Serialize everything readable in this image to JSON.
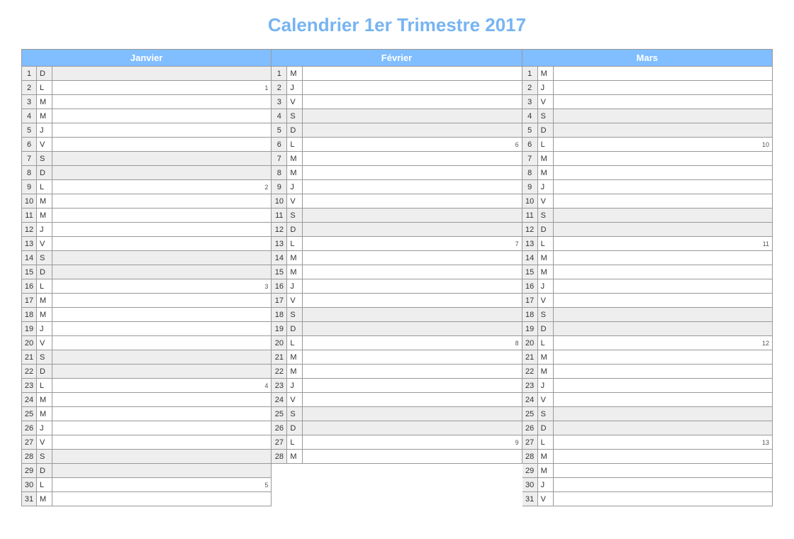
{
  "title": "Calendrier 1er Trimestre 2017",
  "colors": {
    "accent": "#80beff",
    "titleColor": "#77b4f2",
    "shade": "#eee"
  },
  "dowLetters": {
    "mon": "L",
    "tue": "M",
    "wed": "M",
    "thu": "J",
    "fri": "V",
    "sat": "S",
    "sun": "D"
  },
  "months": [
    {
      "name": "Janvier",
      "days": [
        {
          "n": 1,
          "dow": "D",
          "weekend": true,
          "holiday": true
        },
        {
          "n": 2,
          "dow": "L",
          "week": 1
        },
        {
          "n": 3,
          "dow": "M"
        },
        {
          "n": 4,
          "dow": "M"
        },
        {
          "n": 5,
          "dow": "J"
        },
        {
          "n": 6,
          "dow": "V"
        },
        {
          "n": 7,
          "dow": "S",
          "weekend": true
        },
        {
          "n": 8,
          "dow": "D",
          "weekend": true
        },
        {
          "n": 9,
          "dow": "L",
          "week": 2
        },
        {
          "n": 10,
          "dow": "M"
        },
        {
          "n": 11,
          "dow": "M"
        },
        {
          "n": 12,
          "dow": "J"
        },
        {
          "n": 13,
          "dow": "V"
        },
        {
          "n": 14,
          "dow": "S",
          "weekend": true
        },
        {
          "n": 15,
          "dow": "D",
          "weekend": true
        },
        {
          "n": 16,
          "dow": "L",
          "week": 3
        },
        {
          "n": 17,
          "dow": "M"
        },
        {
          "n": 18,
          "dow": "M"
        },
        {
          "n": 19,
          "dow": "J"
        },
        {
          "n": 20,
          "dow": "V"
        },
        {
          "n": 21,
          "dow": "S",
          "weekend": true
        },
        {
          "n": 22,
          "dow": "D",
          "weekend": true
        },
        {
          "n": 23,
          "dow": "L",
          "week": 4
        },
        {
          "n": 24,
          "dow": "M"
        },
        {
          "n": 25,
          "dow": "M"
        },
        {
          "n": 26,
          "dow": "J"
        },
        {
          "n": 27,
          "dow": "V"
        },
        {
          "n": 28,
          "dow": "S",
          "weekend": true
        },
        {
          "n": 29,
          "dow": "D",
          "weekend": true
        },
        {
          "n": 30,
          "dow": "L",
          "week": 5
        },
        {
          "n": 31,
          "dow": "M"
        }
      ]
    },
    {
      "name": "Février",
      "days": [
        {
          "n": 1,
          "dow": "M"
        },
        {
          "n": 2,
          "dow": "J"
        },
        {
          "n": 3,
          "dow": "V"
        },
        {
          "n": 4,
          "dow": "S",
          "weekend": true
        },
        {
          "n": 5,
          "dow": "D",
          "weekend": true
        },
        {
          "n": 6,
          "dow": "L",
          "week": 6
        },
        {
          "n": 7,
          "dow": "M"
        },
        {
          "n": 8,
          "dow": "M"
        },
        {
          "n": 9,
          "dow": "J"
        },
        {
          "n": 10,
          "dow": "V"
        },
        {
          "n": 11,
          "dow": "S",
          "weekend": true
        },
        {
          "n": 12,
          "dow": "D",
          "weekend": true
        },
        {
          "n": 13,
          "dow": "L",
          "week": 7
        },
        {
          "n": 14,
          "dow": "M"
        },
        {
          "n": 15,
          "dow": "M"
        },
        {
          "n": 16,
          "dow": "J"
        },
        {
          "n": 17,
          "dow": "V"
        },
        {
          "n": 18,
          "dow": "S",
          "weekend": true
        },
        {
          "n": 19,
          "dow": "D",
          "weekend": true
        },
        {
          "n": 20,
          "dow": "L",
          "week": 8
        },
        {
          "n": 21,
          "dow": "M"
        },
        {
          "n": 22,
          "dow": "M"
        },
        {
          "n": 23,
          "dow": "J"
        },
        {
          "n": 24,
          "dow": "V"
        },
        {
          "n": 25,
          "dow": "S",
          "weekend": true
        },
        {
          "n": 26,
          "dow": "D",
          "weekend": true
        },
        {
          "n": 27,
          "dow": "L",
          "week": 9
        },
        {
          "n": 28,
          "dow": "M"
        }
      ]
    },
    {
      "name": "Mars",
      "days": [
        {
          "n": 1,
          "dow": "M"
        },
        {
          "n": 2,
          "dow": "J"
        },
        {
          "n": 3,
          "dow": "V"
        },
        {
          "n": 4,
          "dow": "S",
          "weekend": true
        },
        {
          "n": 5,
          "dow": "D",
          "weekend": true
        },
        {
          "n": 6,
          "dow": "L",
          "week": 10
        },
        {
          "n": 7,
          "dow": "M"
        },
        {
          "n": 8,
          "dow": "M"
        },
        {
          "n": 9,
          "dow": "J"
        },
        {
          "n": 10,
          "dow": "V"
        },
        {
          "n": 11,
          "dow": "S",
          "weekend": true
        },
        {
          "n": 12,
          "dow": "D",
          "weekend": true
        },
        {
          "n": 13,
          "dow": "L",
          "week": 11
        },
        {
          "n": 14,
          "dow": "M"
        },
        {
          "n": 15,
          "dow": "M"
        },
        {
          "n": 16,
          "dow": "J"
        },
        {
          "n": 17,
          "dow": "V"
        },
        {
          "n": 18,
          "dow": "S",
          "weekend": true
        },
        {
          "n": 19,
          "dow": "D",
          "weekend": true
        },
        {
          "n": 20,
          "dow": "L",
          "week": 12
        },
        {
          "n": 21,
          "dow": "M"
        },
        {
          "n": 22,
          "dow": "M"
        },
        {
          "n": 23,
          "dow": "J"
        },
        {
          "n": 24,
          "dow": "V"
        },
        {
          "n": 25,
          "dow": "S",
          "weekend": true
        },
        {
          "n": 26,
          "dow": "D",
          "weekend": true
        },
        {
          "n": 27,
          "dow": "L",
          "week": 13
        },
        {
          "n": 28,
          "dow": "M"
        },
        {
          "n": 29,
          "dow": "M"
        },
        {
          "n": 30,
          "dow": "J"
        },
        {
          "n": 31,
          "dow": "V"
        }
      ]
    }
  ]
}
